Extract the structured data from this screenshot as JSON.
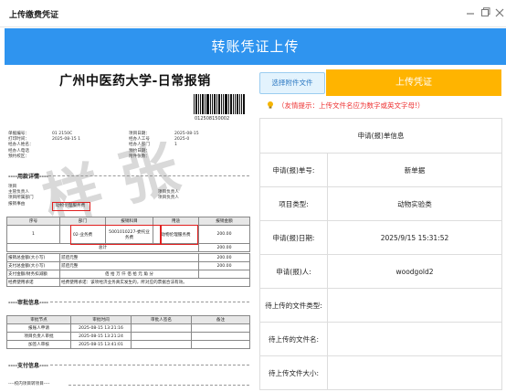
{
  "window": {
    "title": "上传缴费凭证",
    "controls": [
      "minimize-icon",
      "maximize-icon",
      "close-icon"
    ]
  },
  "banner": {
    "title": "转账凭证上传"
  },
  "document": {
    "title": "广州中医药大学-日常报销",
    "barcode_number": "012508150002",
    "stamp_text": "样 张",
    "info_left": [
      "单据编号：",
      "打印时间：",
      "经办人姓名：",
      "经办人电话",
      "预约校区："
    ],
    "info_left_values": [
      "01   2150C",
      "2025-08-15 1",
      "",
      "",
      ""
    ],
    "info_right": [
      "项目日期：",
      "经办人工号",
      "经办人部门",
      "预约日期：",
      "附件张数："
    ],
    "info_right_values": [
      "2025-08-15",
      "",
      "",
      "2025-0",
      "1"
    ],
    "section_usage": "----用款详情----",
    "usage_fields": [
      "项目",
      "主管负责人",
      "项目所属部门",
      "报销事由"
    ],
    "usage_fields_right": [
      "项目负责人",
      "项目负责人"
    ],
    "usage_reason_value": "动物伦理服务费",
    "detail_headers": [
      "序号",
      "部门",
      "报销科目",
      "用途",
      "报销金额"
    ],
    "detail_row": [
      "1",
      "02-业务费",
      "5001010227-委托业务费",
      "动物伦理服务费",
      "200.00"
    ],
    "detail_total_label": "总计",
    "detail_total_value": "200.00",
    "amount_rows": [
      {
        "label": "报销总金额(大小写)",
        "value": "贰佰元整",
        "amount": "200.00"
      },
      {
        "label": "支付总金额(大小写)",
        "value": "贰佰元整",
        "amount": "200.00"
      },
      {
        "label": "支付金额/财务扣减额",
        "value": "佰  拾  万  仟  佰  拾  元  角  分",
        "amount": ""
      },
      {
        "label": "经费使用承诺",
        "value": "经费使用承诺：该项经济业务真实发生的，所对应的票据合法有效。",
        "amount": ""
      }
    ],
    "section_approval": "----审批信息----",
    "approval_headers": [
      "审批节点",
      "审批时间",
      "审批人签名",
      "备注"
    ],
    "approval_rows": [
      [
        "报账人申请",
        "2025-08-15 13:21:16",
        "",
        ""
      ],
      [
        "项目负责人审批",
        "2025-08-15 13:21:24",
        "",
        ""
      ],
      [
        "加签人审核",
        "2025-08-15 13:41:01",
        "",
        ""
      ]
    ],
    "section_payment": "----支付信息----",
    "section_school": "----校内项目转项目----"
  },
  "actions": {
    "select_attachment": "选择附件文件",
    "upload_voucher": "上传凭证",
    "tip": "（友情提示：上传文件名应为数字或英文字母!）"
  },
  "info_table": {
    "heading": "申请(报)单信息",
    "rows": [
      {
        "label": "申请(报)单号:",
        "value": "新单据"
      },
      {
        "label": "项目类型:",
        "value": "动物实验类"
      },
      {
        "label": "申请(报)日期:",
        "value": "2025/9/15 15:31:52"
      },
      {
        "label": "申请(报)人:",
        "value": "woodgold2"
      },
      {
        "label": "待上传的文件类型:",
        "value": ""
      },
      {
        "label": "待上传的文件名:",
        "value": ""
      },
      {
        "label": "待上传文件大小:",
        "value": ""
      }
    ]
  },
  "colors": {
    "banner": "#2f94ef",
    "upload_button": "#ffb400",
    "tip": "#e33333",
    "highlight_box": "#e02020"
  }
}
